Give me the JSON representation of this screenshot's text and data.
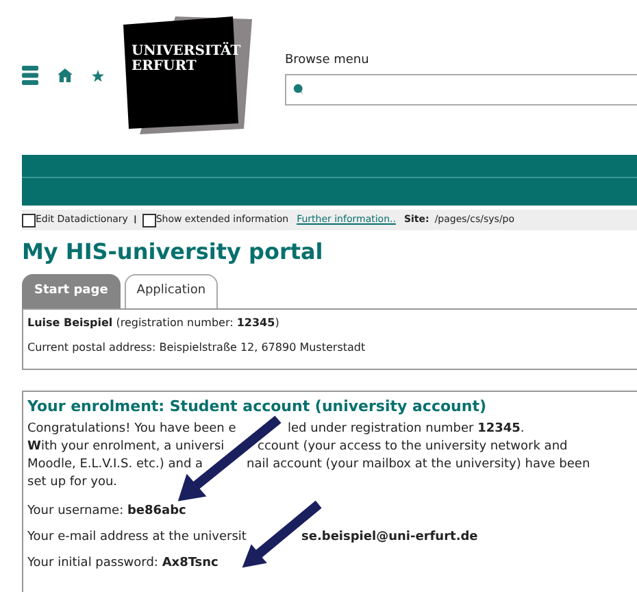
{
  "header": {
    "logo_lines": [
      "UNIVERSITÄT",
      "ERFURT"
    ],
    "search": {
      "label": "Browse menu"
    }
  },
  "toolbar": {
    "options": [
      {
        "label": "Edit Datadictionary",
        "checked": false
      },
      {
        "label": "Show extended information",
        "checked": false
      }
    ],
    "separator": "I",
    "link": "Further information..",
    "site_label": "Site:",
    "site_path": "/pages/cs/sys/po"
  },
  "page_title": "My HIS-university portal",
  "tabs": [
    {
      "label": "Start page",
      "selected": true
    },
    {
      "label": "Application",
      "selected": false
    }
  ],
  "person": {
    "line": "**Luise Beispiel** (registration number: **12345**)",
    "address": "Current postal address: Beispielstraße 12, 67890 Musterstadt"
  },
  "enrolment": {
    "title": "Your enrolment: Student account (university account)",
    "lines": [
      [
        "Congratulations! You have been e",
        "led under registration number **12345**."
      ],
      [
        "**W**ith your enrolment, a universi",
        "ccount (your access to the university network and"
      ],
      [
        "Moodle, E.L.V.I.S. etc.) and a",
        "nail account (your mailbox at the university) have been"
      ],
      [
        "set up for you."
      ]
    ],
    "fields": [
      [
        "Your username: **be86abc**"
      ],
      [
        "Your e-mail address at the universit",
        "**se.beispiel@uni-erfurt.de**"
      ],
      [
        "Your initial password: **Ax8Tsnc**"
      ]
    ]
  }
}
